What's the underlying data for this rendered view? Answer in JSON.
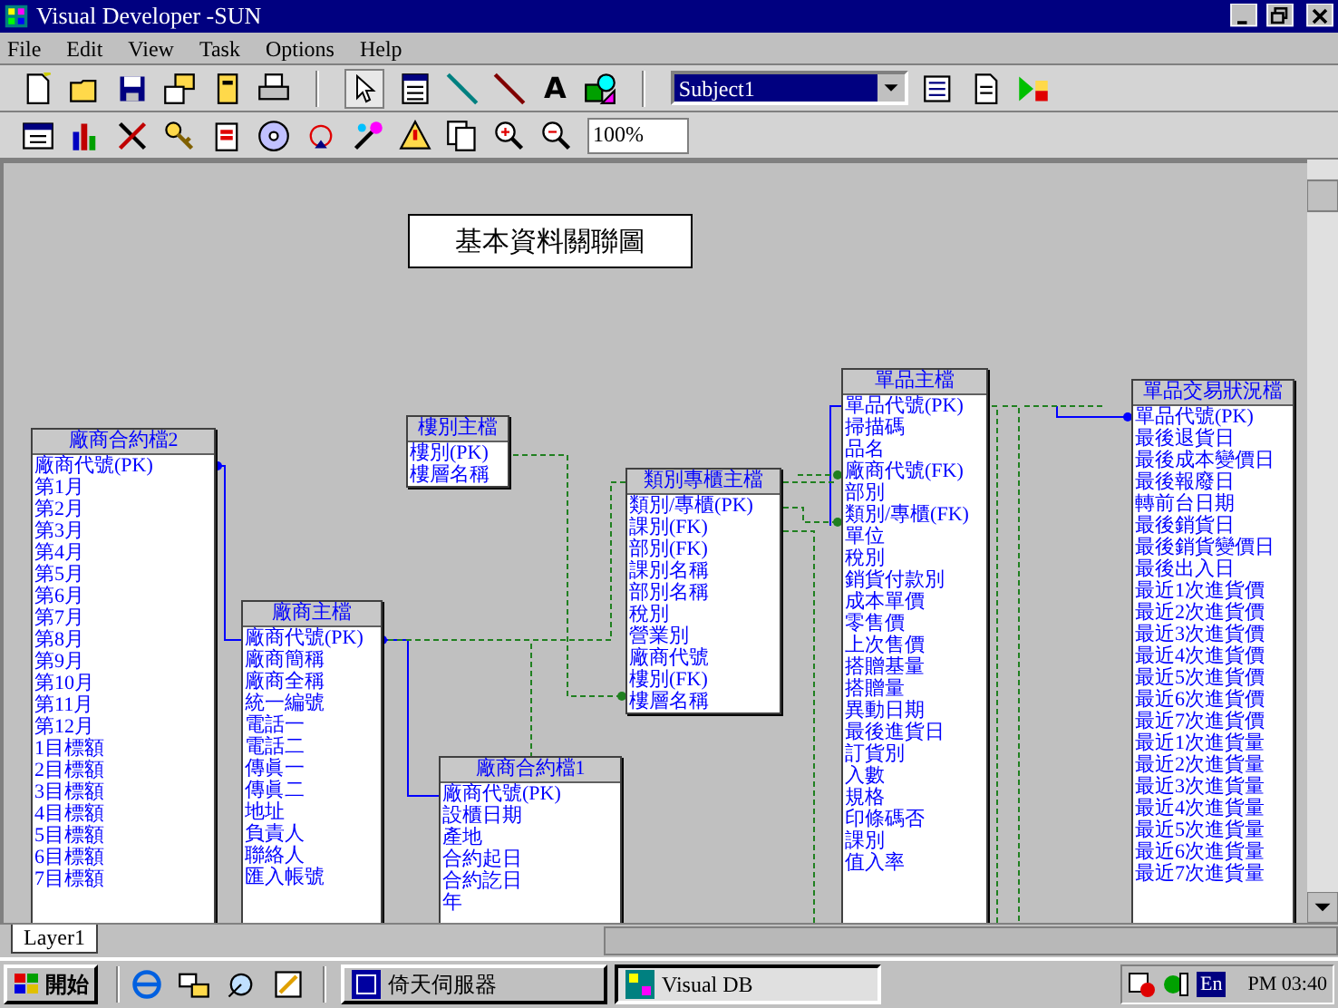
{
  "window": {
    "title": "Visual Developer -SUN"
  },
  "menu": [
    "File",
    "Edit",
    "View",
    "Task",
    "Options",
    "Help"
  ],
  "toolbar": {
    "text_tool": "A",
    "subject": "Subject1",
    "zoom": "100%"
  },
  "diagram": {
    "title": "基本資料關聯圖",
    "tables": [
      {
        "name": "廠商合約檔2",
        "fields": [
          "廠商代號(PK)",
          "第1月",
          "第2月",
          "第3月",
          "第4月",
          "第5月",
          "第6月",
          "第7月",
          "第8月",
          "第9月",
          "第10月",
          "第11月",
          "第12月",
          "1目標額",
          "2目標額",
          "3目標額",
          "4目標額",
          "5目標額",
          "6目標額",
          "7目標額"
        ]
      },
      {
        "name": "廠商主檔",
        "fields": [
          "廠商代號(PK)",
          "廠商簡稱",
          "廠商全稱",
          "統一編號",
          "電話一",
          "電話二",
          "傳眞一",
          "傳眞二",
          "地址",
          "負責人",
          "聯絡人",
          "匯入帳號"
        ]
      },
      {
        "name": "樓別主檔",
        "fields": [
          "樓別(PK)",
          "樓層名稱"
        ]
      },
      {
        "name": "類別專櫃主檔",
        "fields": [
          "類別/專櫃(PK)",
          "課別(FK)",
          "部別(FK)",
          "課別名稱",
          "部別名稱",
          "稅別",
          "營業別",
          "廠商代號",
          "樓別(FK)",
          "樓層名稱"
        ]
      },
      {
        "name": "廠商合約檔1",
        "fields": [
          "廠商代號(PK)",
          "設櫃日期",
          "產地",
          "合約起日",
          "合約訖日",
          "年"
        ]
      },
      {
        "name": "單品主檔",
        "fields": [
          "單品代號(PK)",
          "掃描碼",
          "品名",
          "廠商代號(FK)",
          "部別",
          "類別/專櫃(FK)",
          "單位",
          "稅別",
          "銷貨付款別",
          "成本單價",
          "零售價",
          "上次售價",
          "搭贈基量",
          "搭贈量",
          "異動日期",
          "最後進貨日",
          "訂貨別",
          "入數",
          "規格",
          "印條碼否",
          "課別",
          "值入率"
        ]
      },
      {
        "name": "單品交易狀況檔",
        "fields": [
          "單品代號(PK)",
          "最後退貨日",
          "最後成本變價日",
          "最後報廢日",
          "轉前台日期",
          "最後銷貨日",
          "最後銷貨變價日",
          "最後出入日",
          "最近1次進貨價",
          "最近2次進貨價",
          "最近3次進貨價",
          "最近4次進貨價",
          "最近5次進貨價",
          "最近6次進貨價",
          "最近7次進貨價",
          "最近1次進貨量",
          "最近2次進貨量",
          "最近3次進貨量",
          "最近4次進貨量",
          "最近5次進貨量",
          "最近6次進貨量",
          "最近7次進貨量"
        ]
      }
    ]
  },
  "layer_tabs": [
    {
      "label": "Layer1",
      "selected": true
    }
  ],
  "taskbar": {
    "start": "開始",
    "tasks": [
      {
        "label": "倚天伺服器",
        "selected": false
      },
      {
        "label": "Visual DB",
        "selected": true
      }
    ],
    "input_method": "En",
    "clock": "PM 03:40"
  }
}
